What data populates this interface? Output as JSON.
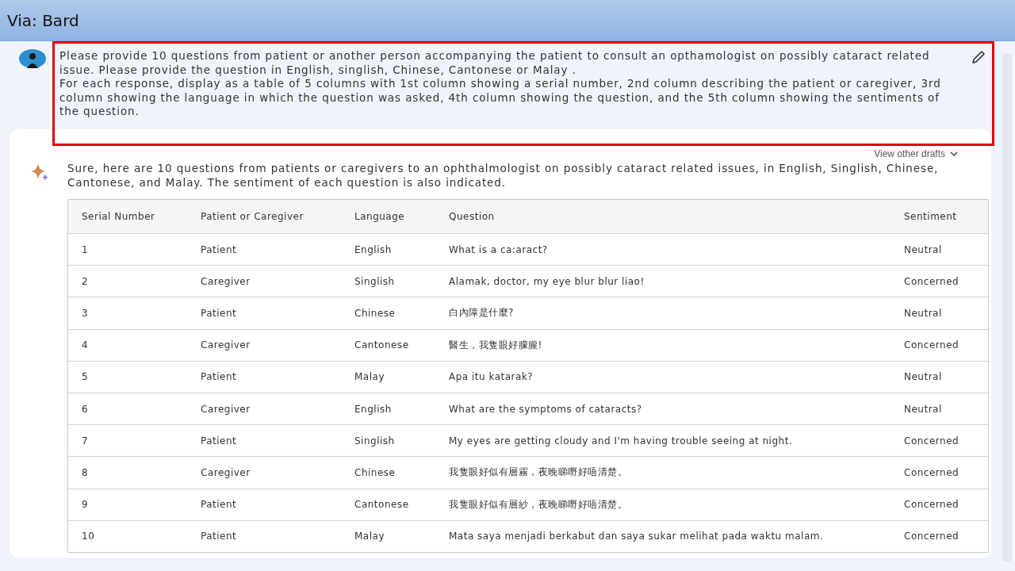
{
  "header": {
    "title": "Via: Bard"
  },
  "prompt": {
    "lines": [
      "Please provide 10 questions from patient or another person accompanying the patient to consult an opthamologist on possibly cataract related issue. Please provide the question in English, singlish, Chinese, Cantonese or Malay .",
      "For each response, display as a table of 5 columns with 1st column showing a serial number, 2nd column describing the patient or caregiver, 3rd column showing the language in which the question was asked, 4th column showing the question, and the 5th column showing the sentiments of the question."
    ],
    "highlighted": true
  },
  "drafts": {
    "label": "View other drafts"
  },
  "response": {
    "intro": "Sure, here are 10 questions from patients or caregivers to an ophthalmologist on possibly cataract related issues, in English, Singlish, Chinese, Cantonese, and Malay. The sentiment of each question is also indicated.",
    "table": {
      "columns": [
        "Serial Number",
        "Patient or Caregiver",
        "Language",
        "Question",
        "Sentiment"
      ],
      "rows": [
        [
          "1",
          "Patient",
          "English",
          "What is a ca:aract?",
          "Neutral"
        ],
        [
          "2",
          "Caregiver",
          "Singlish",
          "Alamak, doctor, my eye blur blur liao!",
          "Concerned"
        ],
        [
          "3",
          "Patient",
          "Chinese",
          "白內障是什麼?",
          "Neutral"
        ],
        [
          "4",
          "Caregiver",
          "Cantonese",
          "醫生，我隻眼好朦朧!",
          "Concerned"
        ],
        [
          "5",
          "Patient",
          "Malay",
          "Apa itu katarak?",
          "Neutral"
        ],
        [
          "6",
          "Caregiver",
          "English",
          "What are the symptoms of cataracts?",
          "Neutral"
        ],
        [
          "7",
          "Patient",
          "Singlish",
          "My eyes are getting cloudy and I'm having trouble seeing at night.",
          "Concerned"
        ],
        [
          "8",
          "Caregiver",
          "Chinese",
          "我隻眼好似有層霧，夜晚睇嘢好唔清楚。",
          "Concerned"
        ],
        [
          "9",
          "Patient",
          "Cantonese",
          "我隻眼好似有層紗，夜晚睇嘢好唔清楚。",
          "Concerned"
        ],
        [
          "10",
          "Patient",
          "Malay",
          "Mata saya menjadi berkabut dan saya sukar melihat pada waktu malam.",
          "Concerned"
        ]
      ]
    }
  }
}
